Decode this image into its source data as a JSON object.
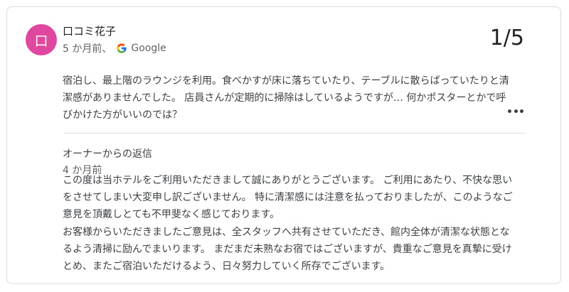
{
  "reviewer": {
    "avatar_initial": "口",
    "name": "口コミ花子",
    "time_ago": "5 か月前、",
    "source": "Google"
  },
  "rating_text": "1/5",
  "review_text": "宿泊し、最上階のラウンジを利用。食べかすが床に落ちていたり、テーブルに散らばっていたりと清潔感がありませんでした。 店員さんが定期的に掃除はしているようですが… 何かポスターとかで呼びかけた方がいいのでは？",
  "owner_reply": {
    "title": "オーナーからの返信",
    "time_ago": "4 か月前",
    "paragraph1": "この度は当ホテルをご利用いただきまして誠にありがとうございます。 ご利用にあたり、不快な思いをさせてしまい大変申し訳ございません。 特に清潔感には注意を払っておりましたが、このようなご意見を頂戴しとても不甲斐なく感じております。",
    "paragraph2": "お客様からいただきましたご意見は、全スタッフへ共有させていただき、館内全体が清潔な状態となるよう清掃に励んでまいります。 まだまだ未熟なお宿ではございますが、貴重なご意見を真摯に受けとめ、またご宿泊いただけるよう、日々努力していく所存でございます。"
  },
  "icons": {
    "source_logo": "google-g-icon",
    "menu": "more-horizontal-icon"
  },
  "colors": {
    "avatar": "#e0479e",
    "border": "#dadce0",
    "text": "#3c4043",
    "secondary": "#5f6368"
  }
}
